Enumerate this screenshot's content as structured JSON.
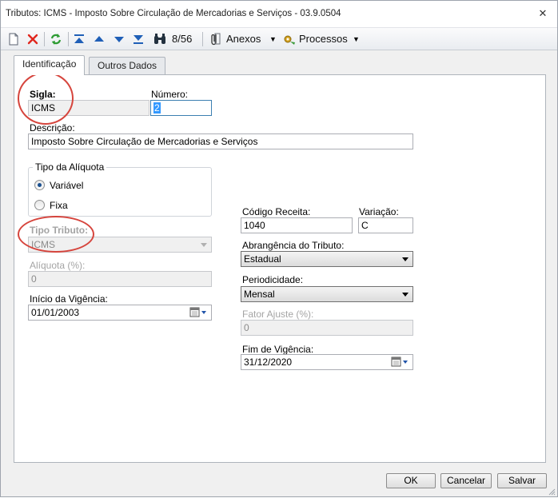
{
  "window": {
    "title": "Tributos: ICMS - Imposto Sobre Circulação de Mercadorias e Serviços - 03.9.0504",
    "close_glyph": "✕"
  },
  "toolbar": {
    "record_position": "8/56",
    "anexos_label": "Anexos",
    "processos_label": "Processos",
    "icons": [
      "new-icon",
      "delete-icon",
      "refresh-icon",
      "first-icon",
      "previous-icon",
      "next-icon",
      "last-icon",
      "binoculars-icon",
      "paperclip-icon",
      "gear-process-icon"
    ]
  },
  "tabs": [
    {
      "label": "Identificação",
      "active": true
    },
    {
      "label": "Outros Dados",
      "active": false
    }
  ],
  "form": {
    "sigla": {
      "label": "Sigla:",
      "value": "ICMS"
    },
    "numero": {
      "label": "Número:",
      "value": "2"
    },
    "descricao": {
      "label": "Descrição:",
      "value": "Imposto Sobre Circulação de Mercadorias e Serviços"
    },
    "tipo_aliquota": {
      "label": "Tipo da Alíquota",
      "options": [
        "Variável",
        "Fixa"
      ],
      "selected": "Variável"
    },
    "tipo_tributo": {
      "label": "Tipo Tributo:",
      "value": "ICMS"
    },
    "aliquota": {
      "label": "Alíquota (%):",
      "value": "0"
    },
    "inicio_vigencia": {
      "label": "Início da Vigência:",
      "value": "01/01/2003"
    },
    "codigo_receita": {
      "label": "Código Receita:",
      "value": "1040"
    },
    "variacao": {
      "label": "Variação:",
      "value": "C"
    },
    "abrangencia": {
      "label": "Abrangência do Tributo:",
      "value": "Estadual"
    },
    "periodicidade": {
      "label": "Periodicidade:",
      "value": "Mensal"
    },
    "fator_ajuste": {
      "label": "Fator Ajuste (%):",
      "value": "0"
    },
    "fim_vigencia": {
      "label": "Fim de Vigência:",
      "value": "31/12/2020"
    }
  },
  "buttons": {
    "ok": "OK",
    "cancelar": "Cancelar",
    "salvar": "Salvar"
  },
  "colors": {
    "annotation_circle": "#d6453d",
    "selection": "#3399ff",
    "focus_border": "#3c7fb1"
  }
}
